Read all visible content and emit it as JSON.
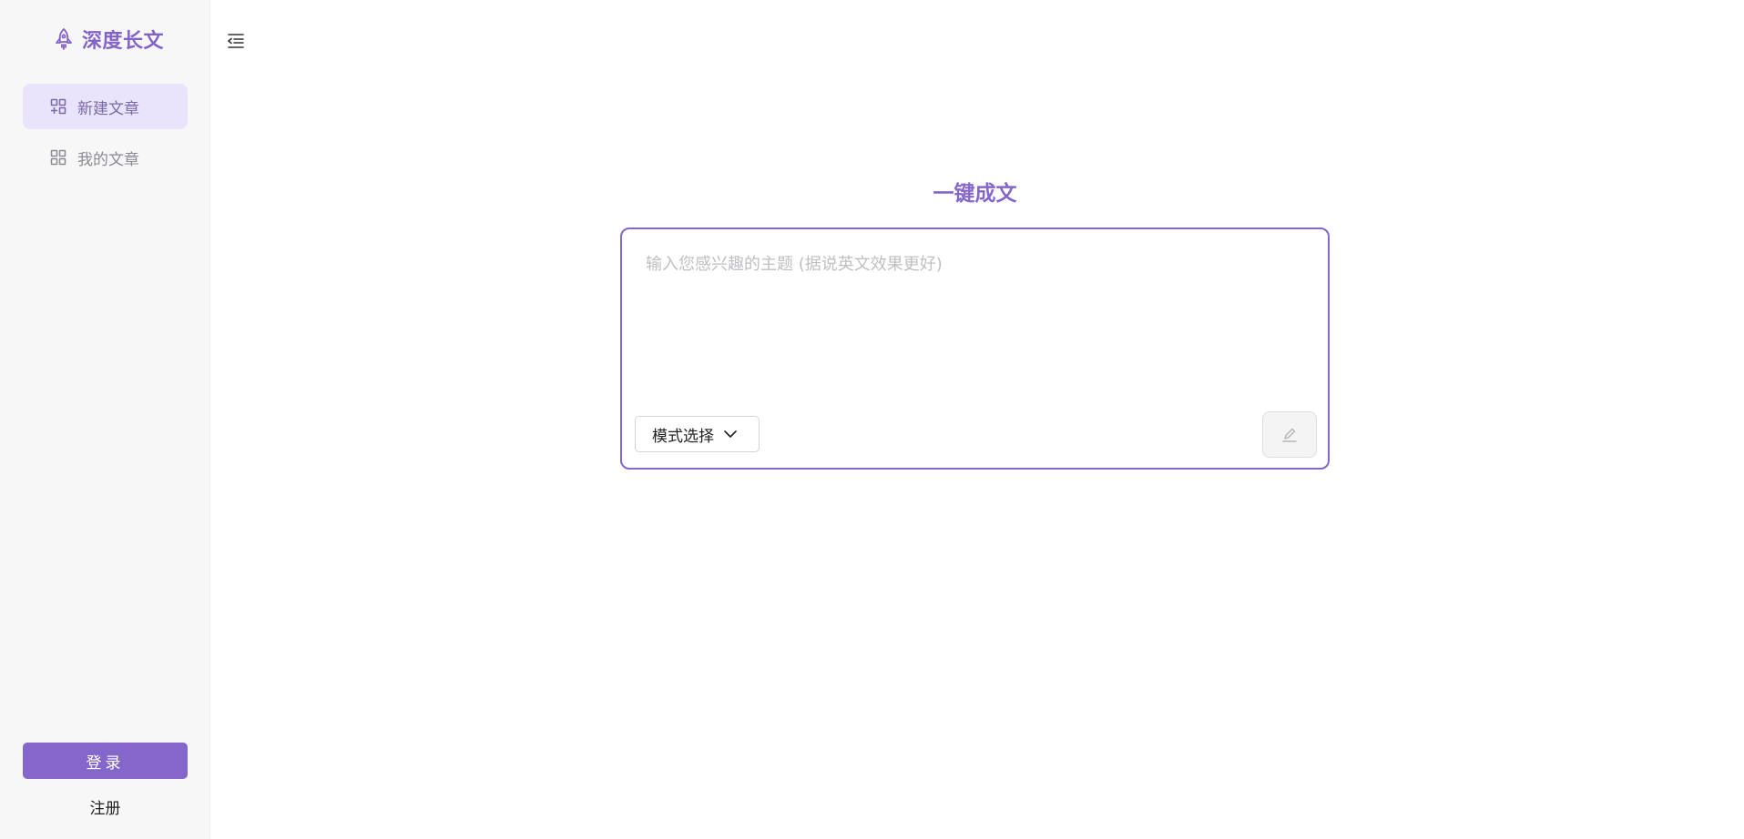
{
  "sidebar": {
    "brand": {
      "name": "深度长文",
      "icon": "rocket-icon"
    },
    "items": [
      {
        "label": "新建文章",
        "icon": "new-article-icon",
        "active": true
      },
      {
        "label": "我的文章",
        "icon": "grid-icon",
        "active": false
      }
    ],
    "login_label": "登录",
    "register_label": "注册"
  },
  "header": {
    "collapse_icon": "collapse-sidebar-icon"
  },
  "main": {
    "title": "一键成文",
    "input": {
      "value": "",
      "placeholder": "输入您感兴趣的主题 (据说英文效果更好)"
    },
    "mode_select": {
      "label": "模式选择",
      "icon": "chevron-down-icon"
    },
    "submit": {
      "icon": "pencil-icon",
      "enabled": false
    }
  },
  "colors": {
    "accent": "#8566cb",
    "accent_light": "#e9e3fb",
    "sidebar_bg": "#f7f7f8",
    "placeholder": "#bfbfc4"
  }
}
